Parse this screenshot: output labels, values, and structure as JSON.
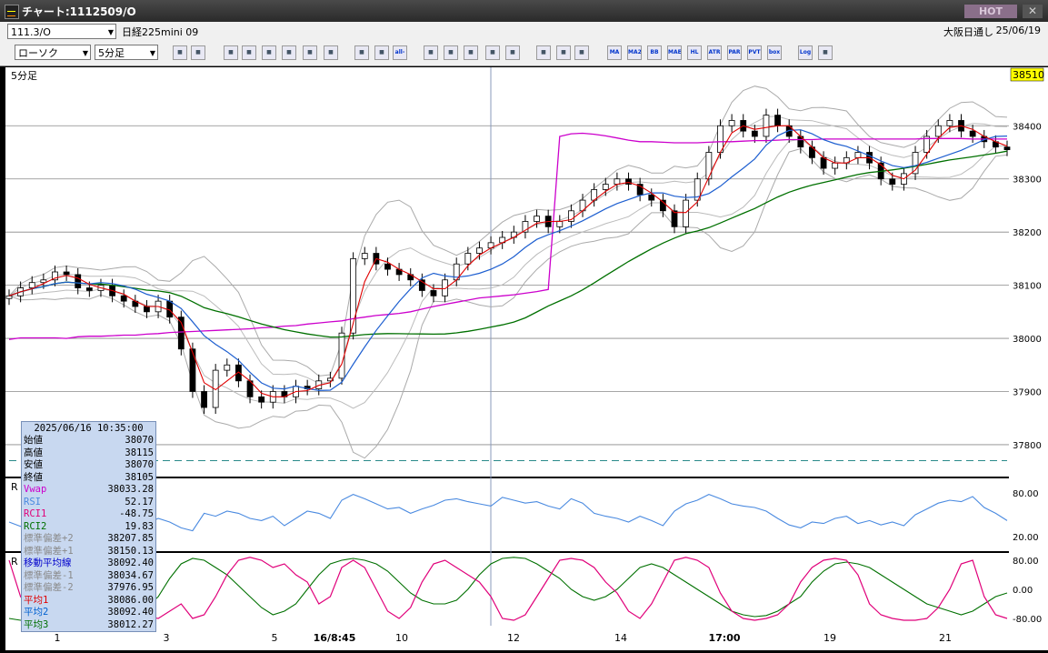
{
  "window": {
    "title": "チャート:1112509/O",
    "hot_label": "HOT",
    "close_label": "✕"
  },
  "header": {
    "code": "111.3/O",
    "instrument": "日経225mini 09",
    "market": "大阪日通し",
    "date": "25/06/19",
    "chart_type": "ローソク",
    "interval": "5分足"
  },
  "toolbar": {
    "buttons": [
      "zoom-icon",
      "window-icon",
      "pen-icon",
      "eraser-icon",
      "cursor-icon",
      "back-icon",
      "list-icon",
      "trash-icon",
      "candle-add-icon",
      "candle-remove-icon",
      "all-button",
      "range-icon",
      "search-icon",
      "chart-icon",
      "split-icon",
      "flag-icon",
      "grid-icon",
      "tool-icon",
      "color-icon",
      "MA",
      "MA2",
      "BB",
      "MAE",
      "HL",
      "ATR",
      "PAR",
      "PVT",
      "box",
      "Log",
      "export-icon"
    ]
  },
  "main_panel": {
    "label": "5分足",
    "current_price": "38510",
    "price_ticks": [
      "38400",
      "38300",
      "38200",
      "38100",
      "38000",
      "37900",
      "37800"
    ]
  },
  "rsi_panel": {
    "label": "R",
    "ticks": [
      "80.00",
      "20.00"
    ]
  },
  "rci_panel": {
    "label": "R",
    "ticks": [
      "80.00",
      "0.00",
      "-80.00"
    ]
  },
  "xaxis": {
    "labels": [
      "1",
      "3",
      "5",
      "16/8:45",
      "10",
      "12",
      "14",
      "17:00",
      "19",
      "21"
    ]
  },
  "info": {
    "timestamp": "2025/06/16  10:35:00",
    "rows": [
      {
        "k": "始値",
        "v": "38070",
        "color": "#000000"
      },
      {
        "k": "高値",
        "v": "38115",
        "color": "#000000"
      },
      {
        "k": "安値",
        "v": "38070",
        "color": "#000000"
      },
      {
        "k": "終値",
        "v": "38105",
        "color": "#000000"
      },
      {
        "k": "Vwap",
        "v": "38033.28",
        "color": "#cc00cc"
      },
      {
        "k": "RSI",
        "v": "52.17",
        "color": "#4a8ae0"
      },
      {
        "k": "RCI1",
        "v": "-48.75",
        "color": "#e0007a"
      },
      {
        "k": "RCI2",
        "v": "19.83",
        "color": "#007000"
      },
      {
        "k": "標準偏差+2",
        "v": "38207.85",
        "color": "#8a8a8a"
      },
      {
        "k": "標準偏差+1",
        "v": "38150.13",
        "color": "#8a8a8a"
      },
      {
        "k": "移動平均線",
        "v": "38092.40",
        "color": "#0000cc"
      },
      {
        "k": "標準偏差-1",
        "v": "38034.67",
        "color": "#8a8a8a"
      },
      {
        "k": "標準偏差-2",
        "v": "37976.95",
        "color": "#8a8a8a"
      },
      {
        "k": "平均1",
        "v": "38086.00",
        "color": "#e00000"
      },
      {
        "k": "平均2",
        "v": "38092.40",
        "color": "#0060d0"
      },
      {
        "k": "平均3",
        "v": "38012.27",
        "color": "#007000"
      }
    ]
  },
  "chart_data": {
    "type": "line",
    "title": "",
    "interval": "5分足",
    "ylim": [
      37740,
      38510
    ],
    "close": [
      38080,
      38095,
      38105,
      38110,
      38125,
      38120,
      38095,
      38090,
      38100,
      38080,
      38070,
      38060,
      38050,
      38070,
      38040,
      37980,
      37900,
      37870,
      37940,
      37950,
      37920,
      37890,
      37880,
      37900,
      37890,
      37910,
      37905,
      37920,
      37925,
      38010,
      38150,
      38160,
      38140,
      38130,
      38120,
      38110,
      38090,
      38080,
      38110,
      38140,
      38160,
      38170,
      38180,
      38190,
      38200,
      38220,
      38230,
      38210,
      38220,
      38240,
      38260,
      38280,
      38290,
      38300,
      38290,
      38270,
      38260,
      38240,
      38210,
      38260,
      38300,
      38350,
      38400,
      38410,
      38390,
      38380,
      38420,
      38400,
      38380,
      38360,
      38340,
      38320,
      38330,
      38340,
      38350,
      38330,
      38300,
      38290,
      38310,
      38350,
      38380,
      38400,
      38410,
      38390,
      38380,
      38370,
      38360,
      38355
    ],
    "vwap": [
      37998,
      38001,
      38001,
      38001,
      38001,
      38000,
      38003,
      38004,
      38004,
      38005,
      38006,
      38006,
      38008,
      38009,
      38011,
      38012,
      38013,
      38014,
      38015,
      38016,
      38017,
      38018,
      38020,
      38021,
      38023,
      38024,
      38027,
      38029,
      38031,
      38033,
      38037,
      38040,
      38043,
      38045,
      38047,
      38050,
      38055,
      38060,
      38064,
      38068,
      38072,
      38076,
      38078,
      38080,
      38082,
      38085,
      38088,
      38092,
      38380,
      38385,
      38386,
      38384,
      38381,
      38377,
      38373,
      38370,
      38370,
      38369,
      38368,
      38368,
      38368,
      38369,
      38370,
      38370,
      38371,
      38372,
      38372,
      38373,
      38374,
      38374,
      38374,
      38375,
      38375,
      38375,
      38375,
      38375,
      38375,
      38375,
      38375,
      38375,
      38376,
      38376,
      38376,
      38376,
      38375,
      38375,
      38375,
      38375
    ],
    "rsi": [
      40,
      34,
      45,
      55,
      48,
      57,
      55,
      70,
      65,
      50,
      45,
      30,
      38,
      45,
      40,
      32,
      28,
      52,
      48,
      55,
      52,
      45,
      42,
      48,
      35,
      45,
      55,
      52,
      45,
      70,
      78,
      72,
      65,
      58,
      60,
      52,
      58,
      63,
      70,
      72,
      68,
      65,
      62,
      74,
      70,
      66,
      68,
      62,
      58,
      72,
      66,
      52,
      48,
      45,
      40,
      48,
      42,
      35,
      55,
      65,
      70,
      78,
      72,
      65,
      62,
      60,
      55,
      45,
      36,
      32,
      40,
      38,
      45,
      48,
      38,
      42,
      36,
      40,
      35,
      50,
      58,
      66,
      70,
      68,
      75,
      60,
      52,
      42
    ],
    "rci1": [
      80,
      -20,
      -60,
      -75,
      10,
      80,
      85,
      30,
      -50,
      -80,
      -70,
      -30,
      -75,
      -80,
      -60,
      -40,
      -80,
      -70,
      -20,
      40,
      80,
      88,
      80,
      60,
      70,
      40,
      20,
      -40,
      -20,
      60,
      80,
      60,
      0,
      -60,
      -80,
      -50,
      20,
      70,
      80,
      60,
      40,
      20,
      -20,
      -80,
      -85,
      -70,
      -20,
      30,
      80,
      85,
      80,
      60,
      20,
      -10,
      -60,
      -80,
      -40,
      20,
      80,
      88,
      80,
      60,
      -10,
      -60,
      -80,
      -85,
      -80,
      -70,
      -40,
      20,
      60,
      80,
      85,
      80,
      40,
      -40,
      -70,
      -80,
      -85,
      -85,
      -80,
      -50,
      0,
      70,
      80,
      -20,
      -70,
      -80
    ],
    "rci2": [
      -80,
      -85,
      -82,
      -80,
      -78,
      -80,
      -85,
      -86,
      -85,
      -82,
      -80,
      -70,
      -50,
      -20,
      30,
      70,
      85,
      80,
      60,
      40,
      10,
      -20,
      -50,
      -70,
      -60,
      -40,
      0,
      40,
      70,
      80,
      85,
      80,
      70,
      50,
      20,
      -10,
      -30,
      -40,
      -40,
      -30,
      0,
      40,
      70,
      85,
      88,
      85,
      70,
      50,
      30,
      0,
      -20,
      -30,
      -20,
      0,
      30,
      60,
      70,
      60,
      40,
      20,
      0,
      -20,
      -40,
      -60,
      -70,
      -75,
      -72,
      -60,
      -40,
      -20,
      20,
      50,
      70,
      75,
      70,
      60,
      40,
      20,
      0,
      -20,
      -40,
      -50,
      -60,
      -70,
      -60,
      -40,
      -20,
      -10
    ]
  }
}
